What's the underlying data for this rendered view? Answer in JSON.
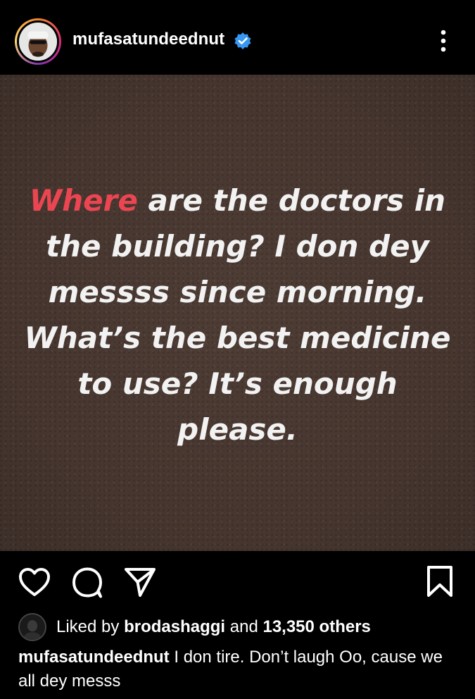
{
  "header": {
    "username": "mufasatundeednut",
    "verified_icon": "verified-badge-icon",
    "more_icon": "more-vertical-icon"
  },
  "post": {
    "quote_highlight": "Where",
    "quote_rest": "are the doctors in the building? I don dey messss since morning. What’s the best medicine to use? It’s enough please.",
    "accent_color": "#ec4552",
    "background_color": "#4a3a33"
  },
  "actions": {
    "like_icon": "heart-icon",
    "comment_icon": "comment-icon",
    "share_icon": "share-icon",
    "save_icon": "bookmark-icon"
  },
  "likes": {
    "prefix": "Liked by",
    "liker": "brodashaggi",
    "connector": "and",
    "others": "13,350 others"
  },
  "caption": {
    "username": "mufasatundeednut",
    "text": "I don tire. Don’t laugh Oo, cause we all dey messs"
  }
}
